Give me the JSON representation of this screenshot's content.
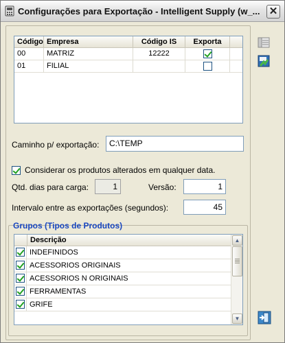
{
  "window": {
    "title": "Configurações para Exportação - Intelligent Supply (w_...",
    "close_symbol": "✕"
  },
  "companies": {
    "columns": [
      "Código",
      "Empresa",
      "Código IS",
      "Exporta"
    ],
    "rows": [
      {
        "codigo": "00",
        "empresa": "MATRIZ",
        "codigo_is": "12222",
        "exporta": true
      },
      {
        "codigo": "01",
        "empresa": "FILIAL",
        "codigo_is": "",
        "exporta": false
      }
    ]
  },
  "export_path": {
    "label": "Caminho p/ exportação:",
    "value": "C:\\TEMP"
  },
  "consider_altered": {
    "label": "Considerar os produtos alterados em qualquer data.",
    "checked": true
  },
  "days_load": {
    "label": "Qtd. dias para carga:",
    "value": "1"
  },
  "version": {
    "label": "Versão:",
    "value": "1"
  },
  "interval": {
    "label": "Intervalo entre as exportações (segundos):",
    "value": "45"
  },
  "groups": {
    "title": "Grupos (Tipos de Produtos)",
    "column": "Descrição",
    "items": [
      {
        "label": "INDEFINIDOS",
        "checked": true
      },
      {
        "label": "ACESSORIOS ORIGINAIS",
        "checked": true
      },
      {
        "label": "ACESSORIOS N ORIGINAIS",
        "checked": true
      },
      {
        "label": "FERRAMENTAS",
        "checked": true
      },
      {
        "label": "GRIFE",
        "checked": true
      }
    ]
  },
  "icons": {
    "title": "window-app-icon",
    "columns_button": "grid-columns-icon",
    "save_button": "save-export-icon",
    "exit_button": "exit-door-icon"
  },
  "colors": {
    "group_title": "#1846c0",
    "check": "#21a121",
    "field_border": "#7f9db9"
  }
}
